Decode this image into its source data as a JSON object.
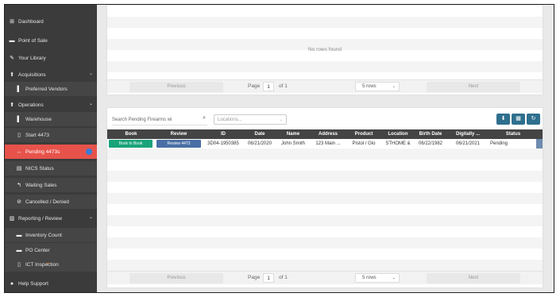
{
  "sidebar": {
    "items": [
      {
        "label": "Dashboard",
        "icon": "dashboard-icon",
        "glyph": "⊞"
      },
      {
        "label": "Point of Sale",
        "icon": "register-icon",
        "glyph": "▬"
      },
      {
        "label": "Your Library",
        "icon": "library-icon",
        "glyph": "✎"
      },
      {
        "label": "Acquisitions",
        "icon": "acquisition-icon",
        "glyph": "⬆"
      },
      {
        "label": "Preferred Vendors",
        "icon": "vendor-icon",
        "glyph": "▌"
      },
      {
        "label": "Operations",
        "icon": "operations-icon",
        "glyph": "⬆"
      },
      {
        "label": "Warehouse",
        "icon": "warehouse-icon",
        "glyph": "▌"
      },
      {
        "label": "Start 4473",
        "icon": "clipboard-icon",
        "glyph": "▯"
      },
      {
        "label": "Pending 4473s",
        "icon": "pending-icon",
        "glyph": "↔"
      },
      {
        "label": "NICS Status",
        "icon": "status-icon",
        "glyph": "▤"
      },
      {
        "label": "Waiting Sales",
        "icon": "waiting-icon",
        "glyph": "↰"
      },
      {
        "label": "Cancelled / Denied",
        "icon": "cancel-icon",
        "glyph": "⊘"
      },
      {
        "label": "Reporting / Review",
        "icon": "report-icon",
        "glyph": "▥"
      },
      {
        "label": "Inventory Count",
        "icon": "inventory-icon",
        "glyph": "▬"
      },
      {
        "label": "PO Center",
        "icon": "po-icon",
        "glyph": "▬"
      },
      {
        "label": "ICT Inspection",
        "icon": "inspection-icon",
        "glyph": "▯"
      },
      {
        "label": "Help Support",
        "icon": "help-icon",
        "glyph": "●"
      }
    ]
  },
  "top_table": {
    "empty_message": "No rows found",
    "pager": {
      "previous": "Previous",
      "page_label": "Page",
      "page_value": "1",
      "of_label": "of 1",
      "rows_value": "5 rows",
      "next": "Next"
    }
  },
  "bottom_table": {
    "search_placeholder": "Search Pending Firearms wi",
    "location_placeholder": "Locations...",
    "toolbar": {
      "download": "⬇",
      "print": "▦",
      "refresh": "↻"
    },
    "columns": [
      "Book",
      "Review",
      "ID",
      "Date",
      "Name",
      "Address",
      "Product",
      "Location",
      "Birth Date",
      "Digitally ...",
      "Status"
    ],
    "rows": [
      {
        "book": "Book In Book",
        "review": "Review 4473",
        "id": "3D04-1950385",
        "date": "06/21/2020",
        "name": "John Smith",
        "address": "123 Main ...",
        "product": "Pistol / Glo",
        "location": "STHOME &",
        "birth_date": "06/22/1982",
        "digitally": "06/21/2021",
        "status": "Pending"
      }
    ],
    "pager": {
      "previous": "Previous",
      "page_label": "Page",
      "page_value": "1",
      "of_label": "of 1",
      "rows_value": "5 rows",
      "next": "Next"
    }
  },
  "colors": {
    "sidebar_bg": "#3b3b3b",
    "active_item": "#e7534b",
    "book_button": "#1aa37a",
    "review_button": "#4a6fa5",
    "tool_button": "#2f6f8e",
    "header_bg": "#444444"
  }
}
